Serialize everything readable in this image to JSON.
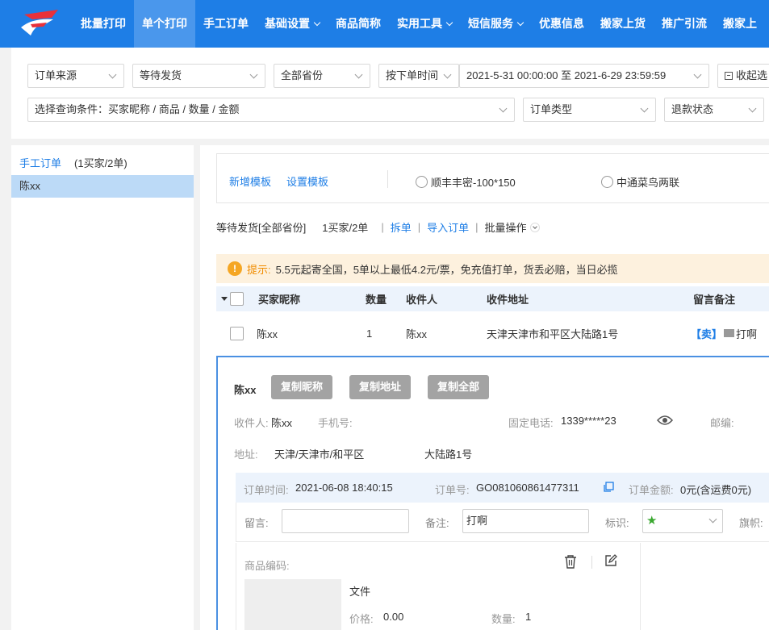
{
  "nav": {
    "items": [
      {
        "label": "批量打印",
        "active": false,
        "dropdown": false
      },
      {
        "label": "单个打印",
        "active": true,
        "dropdown": false
      },
      {
        "label": "手工订单",
        "active": false,
        "dropdown": false
      },
      {
        "label": "基础设置",
        "active": false,
        "dropdown": true
      },
      {
        "label": "商品简称",
        "active": false,
        "dropdown": false
      },
      {
        "label": "实用工具",
        "active": false,
        "dropdown": true
      },
      {
        "label": "短信服务",
        "active": false,
        "dropdown": true
      },
      {
        "label": "优惠信息",
        "active": false,
        "dropdown": false
      },
      {
        "label": "搬家上货",
        "active": false,
        "dropdown": false
      },
      {
        "label": "推广引流",
        "active": false,
        "dropdown": false
      },
      {
        "label": "搬家上",
        "active": false,
        "dropdown": false
      }
    ]
  },
  "filters": {
    "order_source": "订单来源",
    "order_status": "等待发货",
    "province": "全部省份",
    "time_type": "按下单时间",
    "date_range": "2021-5-31 00:00:00 至 2021-6-29 23:59:59",
    "collapse": "收起选",
    "query_condition": "选择查询条件：买家昵称 / 商品 / 数量 / 金额",
    "order_type": "订单类型",
    "refund_status": "退款状态"
  },
  "left": {
    "title": "手工订单",
    "count": "(1买家/2单)",
    "buyers": [
      "陈xx"
    ]
  },
  "templates": {
    "add": "新增模板",
    "settings": "设置模板",
    "options": [
      "顺丰丰密-100*150",
      "中通菜鸟两联"
    ]
  },
  "status": {
    "text": "等待发货[全部省份]",
    "count": "1买家/2单",
    "split": "拆单",
    "import": "导入订单",
    "batch": "批量操作"
  },
  "tip": {
    "label": "提示:",
    "text": "5.5元起寄全国，5单以上最低4.2元/票，免充值打单，货丢必赔，当日必揽"
  },
  "table": {
    "headers": {
      "buyer": "买家昵称",
      "qty": "数量",
      "receiver": "收件人",
      "address": "收件地址",
      "remark": "留言备注"
    },
    "rows": [
      {
        "buyer": "陈xx",
        "qty": "1",
        "receiver": "陈xx",
        "address": "天津天津市和平区大陆路1号",
        "remark_tag": "【卖】",
        "remark": "打啊"
      }
    ]
  },
  "detail": {
    "name": "陈xx",
    "copy_nick": "复制昵称",
    "copy_addr": "复制地址",
    "copy_all": "复制全部",
    "receiver_label": "收件人:",
    "receiver": "陈xx",
    "mobile_label": "手机号:",
    "phone_label": "固定电话:",
    "phone": "1339*****23",
    "postcode_label": "邮编:",
    "address_label": "地址:",
    "address_region": "天津/天津市/和平区",
    "address_street": "大陆路1号",
    "order_time_label": "订单时间:",
    "order_time": "2021-06-08 18:40:15",
    "order_no_label": "订单号:",
    "order_no": "GO081060861477311",
    "amount_label": "订单金额:",
    "amount": "0元(含运费0元)",
    "message_label": "留言:",
    "note_label": "备注:",
    "note": "打啊",
    "mark_label": "标识:",
    "flag_label": "旗帜:",
    "goods_code_label": "商品编码:",
    "goods_name": "文件",
    "price_label": "价格:",
    "price": "0.00",
    "qty_label": "数量:",
    "qty": "1"
  },
  "colors": {
    "nav_bg": "#1e7ee6",
    "link": "#1e7ee6",
    "tip_bg": "#fdf1de",
    "header_bg": "#ecf3fc"
  }
}
